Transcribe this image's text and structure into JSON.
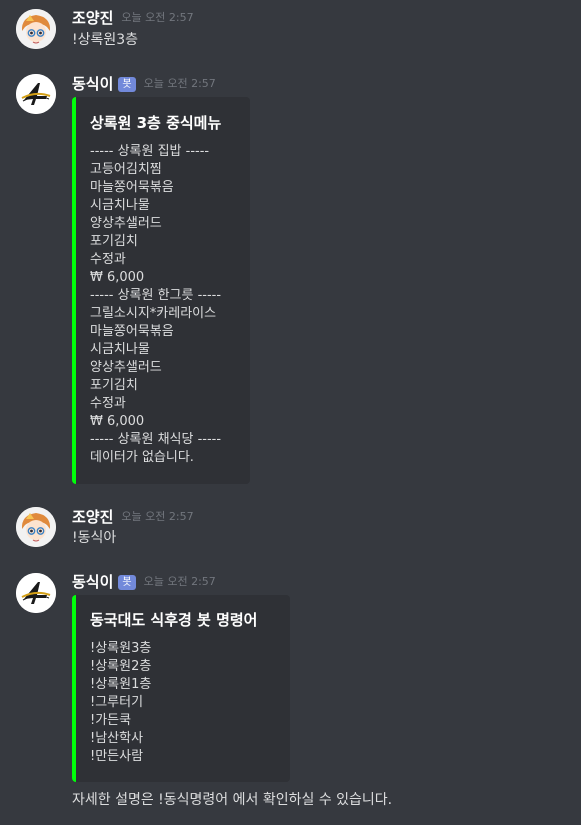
{
  "messages": [
    {
      "author": "조양진",
      "timestamp": "오늘 오전 2:57",
      "text": "!상록원3층"
    },
    {
      "author": "동식이",
      "bot_tag": "봇",
      "timestamp": "오늘 오전 2:57",
      "embed": {
        "title": "상록원 3층 중식메뉴",
        "lines": [
          "----- 상록원 집밥 -----",
          "고등어김치찜",
          "마늘쫑어묵볶음",
          "시금치나물",
          "양상추샐러드",
          "포기김치",
          "수정과",
          "₩ 6,000",
          "----- 상록원 한그릇 -----",
          "그릴소시지*카레라이스",
          "마늘쫑어묵볶음",
          "시금치나물",
          "양상추샐러드",
          "포기김치",
          "수정과",
          "₩ 6,000",
          "----- 상록원 채식당 -----",
          "데이터가 없습니다."
        ]
      }
    },
    {
      "author": "조양진",
      "timestamp": "오늘 오전 2:57",
      "text": "!동식아"
    },
    {
      "author": "동식이",
      "bot_tag": "봇",
      "timestamp": "오늘 오전 2:57",
      "embed": {
        "title": "동국대도 식후경 봇 명령어",
        "lines": [
          "!상록원3층",
          "!상록원2층",
          "!상록원1층",
          "!그루터기",
          "!가든쿡",
          "!남산학사",
          "!만든사람"
        ]
      },
      "footer_text": "자세한 설명은 !동식명령어 에서 확인하실 수 있습니다."
    }
  ],
  "colors": {
    "background": "#36393f",
    "embed_background": "#2f3136",
    "embed_accent": "#00ff0a",
    "bot_tag": "#7289da",
    "timestamp": "#72767d"
  }
}
